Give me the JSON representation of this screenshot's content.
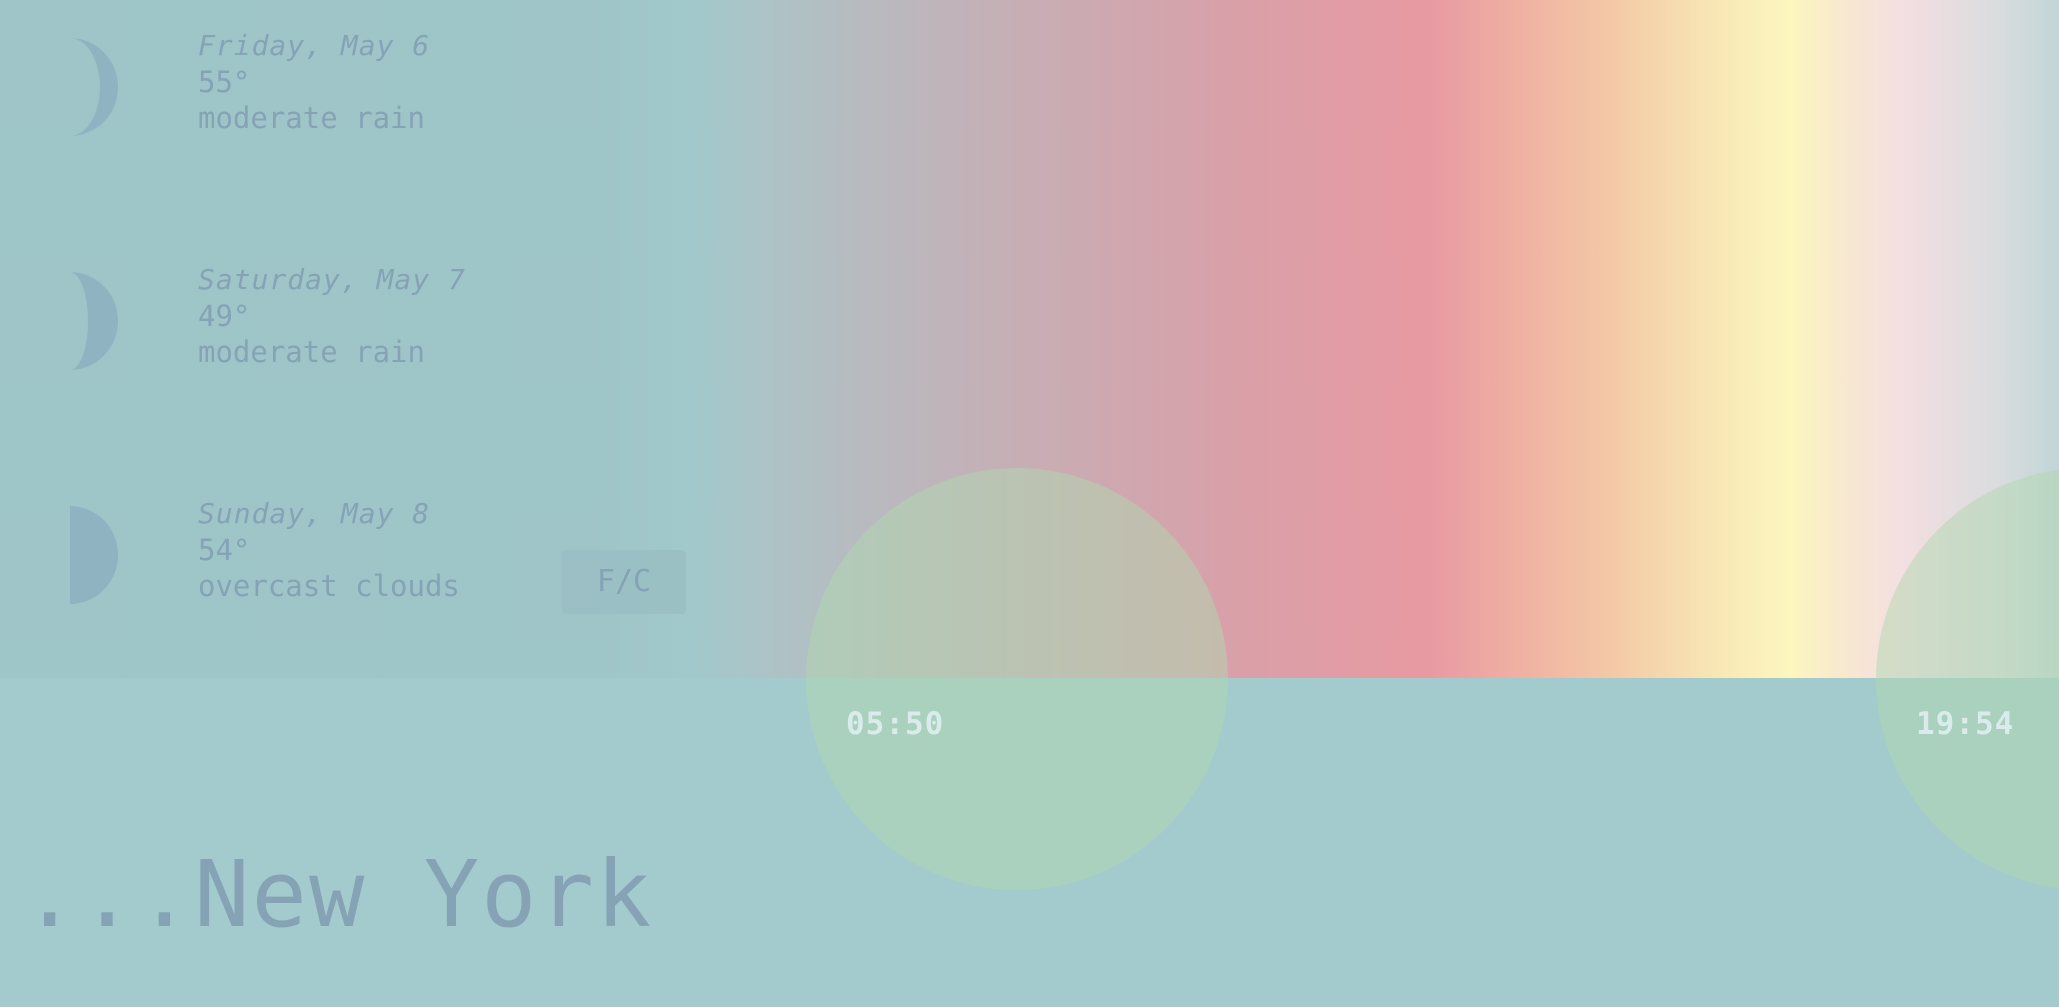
{
  "colors": {
    "background": "#a3cbcd",
    "text": "#86a3b5",
    "time_text": "#d9eceb",
    "sun_circle": "#afd7af"
  },
  "forecast": [
    {
      "date": "Friday, May 6",
      "temp": "55°",
      "condition": "moderate rain",
      "icon": "moon-crescent-icon"
    },
    {
      "date": "Saturday, May 7",
      "temp": "49°",
      "condition": "moderate rain",
      "icon": "moon-crescent-icon"
    },
    {
      "date": "Sunday, May 8",
      "temp": "54°",
      "condition": "overcast clouds",
      "icon": "moon-half-icon"
    }
  ],
  "unit_toggle": {
    "label": "F/C"
  },
  "sun": {
    "sunrise": "05:50",
    "sunset": "19:54"
  },
  "location": {
    "display": "...New York"
  }
}
